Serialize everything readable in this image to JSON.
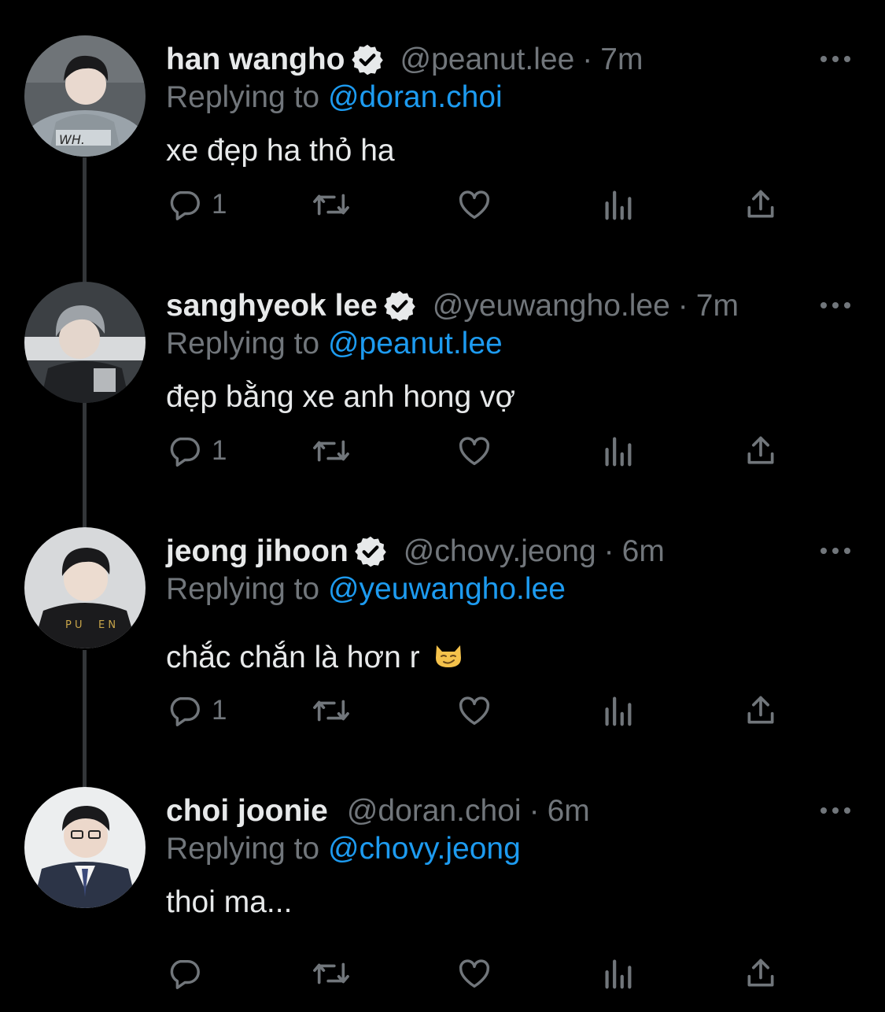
{
  "tweets": [
    {
      "name": "han wangho",
      "verified": true,
      "handle": "@peanut.lee",
      "separator": "·",
      "time": "7m",
      "reply_prefix": "Replying to",
      "reply_to": "@doran.choi",
      "text": "xe đẹp ha thỏ ha",
      "reply_count": "1",
      "avatar_icon": "avatar-photo"
    },
    {
      "name": "sanghyeok lee",
      "verified": true,
      "handle": "@yeuwangho.lee",
      "separator": "·",
      "time": "7m",
      "reply_prefix": "Replying to",
      "reply_to": "@peanut.lee",
      "text": "đẹp bằng xe anh hong vợ",
      "reply_count": "1",
      "avatar_icon": "avatar-photo"
    },
    {
      "name": "jeong jihoon",
      "verified": true,
      "handle": "@chovy.jeong",
      "separator": "·",
      "time": "6m",
      "reply_prefix": "Replying to",
      "reply_to": "@yeuwangho.lee",
      "text": "chắc chắn là hơn r",
      "emoji": "smirk-cat-emoji",
      "reply_count": "1",
      "avatar_icon": "avatar-photo"
    },
    {
      "name": "choi joonie",
      "verified": false,
      "handle": "@doran.choi",
      "separator": "·",
      "time": "6m",
      "reply_prefix": "Replying to",
      "reply_to": "@chovy.jeong",
      "text": "thoi ma...",
      "reply_count": "",
      "avatar_icon": "avatar-photo"
    }
  ],
  "icons": {
    "reply": "reply-icon",
    "retweet": "retweet-icon",
    "like": "heart-icon",
    "views": "analytics-icon",
    "share": "share-icon",
    "more": "more-dots-icon",
    "verified": "verified-badge-icon"
  },
  "colors": {
    "background": "#000000",
    "text": "#e7e9ea",
    "secondary": "#71767b",
    "accent": "#1d9bf0",
    "thread_line": "#333639"
  }
}
